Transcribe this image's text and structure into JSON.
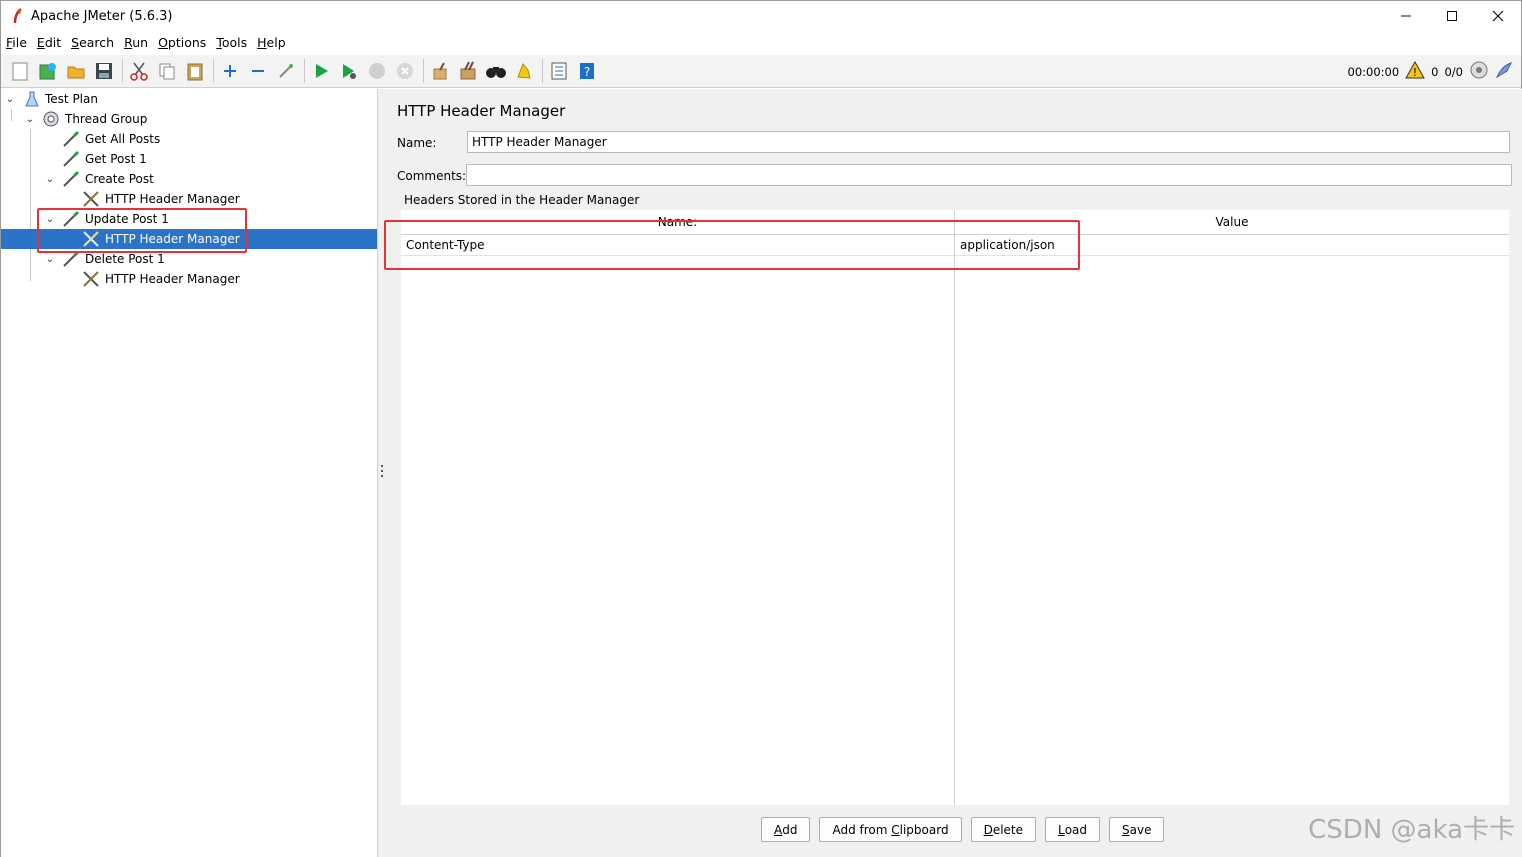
{
  "window": {
    "title": "Apache JMeter (5.6.3)"
  },
  "menu": [
    {
      "key": "F",
      "rest": "ile"
    },
    {
      "key": "E",
      "rest": "dit"
    },
    {
      "key": "S",
      "rest": "earch"
    },
    {
      "key": "R",
      "rest": "un"
    },
    {
      "key": "O",
      "rest": "ptions"
    },
    {
      "key": "T",
      "rest": "ools"
    },
    {
      "key": "H",
      "rest": "elp"
    }
  ],
  "toolbar_status": {
    "timer": "00:00:00",
    "warnings": "0",
    "threads": "0/0"
  },
  "tree": {
    "items": [
      {
        "label": "Test Plan"
      },
      {
        "label": "Thread Group"
      },
      {
        "label": "Get All Posts"
      },
      {
        "label": "Get Post 1"
      },
      {
        "label": "Create Post"
      },
      {
        "label": "HTTP Header Manager"
      },
      {
        "label": "Update Post 1"
      },
      {
        "label": "HTTP Header Manager"
      },
      {
        "label": "Delete Post 1"
      },
      {
        "label": "HTTP Header Manager"
      }
    ]
  },
  "editor": {
    "title": "HTTP Header Manager",
    "name_label": "Name:",
    "name_value": "HTTP Header Manager",
    "comments_label": "Comments:",
    "comments_value": "",
    "group_title": "Headers Stored in the Header Manager",
    "table": {
      "headers": [
        "Name:",
        "Value"
      ],
      "rows": [
        {
          "name": "Content-Type",
          "value": "application/json"
        }
      ]
    },
    "buttons": [
      {
        "key": "A",
        "rest": "dd"
      },
      {
        "pre": "Add from ",
        "key": "C",
        "rest": "lipboard"
      },
      {
        "key": "D",
        "rest": "elete"
      },
      {
        "key": "L",
        "rest": "oad"
      },
      {
        "key": "S",
        "rest": "ave"
      }
    ]
  },
  "watermark": "CSDN @aka卡卡",
  "colors": {
    "selection": "#2a73c7",
    "highlight": "#e8323a"
  }
}
